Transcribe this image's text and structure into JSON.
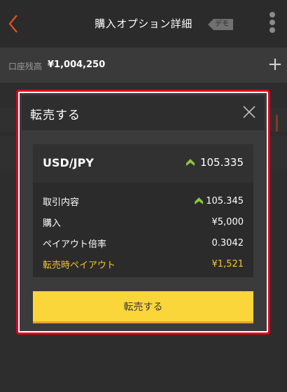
{
  "header": {
    "title": "購入オプション詳細",
    "demo_badge": "デモ"
  },
  "account": {
    "balance_label": "口座残高",
    "balance_value": "¥1,004,250",
    "add_symbol": "+"
  },
  "modal": {
    "title": "転売する",
    "pair": "USD/JPY",
    "current_rate": "105.335",
    "rows": [
      {
        "label": "取引内容",
        "value": "105.345",
        "arrow": true,
        "highlight": false
      },
      {
        "label": "購入",
        "value": "¥5,000",
        "arrow": false,
        "highlight": false
      },
      {
        "label": "ペイアウト倍率",
        "value": "0.3042",
        "arrow": false,
        "highlight": false
      },
      {
        "label": "転売時ペイアウト",
        "value": "¥1,521",
        "arrow": false,
        "highlight": true
      }
    ],
    "button_label": "転売する"
  },
  "colors": {
    "accent_yellow": "#fbd63a",
    "highlight_text": "#f5c531",
    "up_green": "#8dc63f",
    "back_orange": "#e8501e",
    "annotation_red": "#e1001a"
  }
}
